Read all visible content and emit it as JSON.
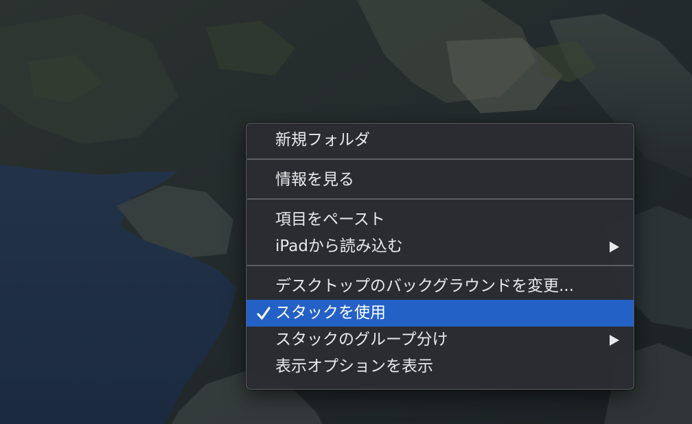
{
  "menu": {
    "items": [
      {
        "label": "新規フォルダ"
      },
      {
        "label": "情報を見る"
      },
      {
        "label": "項目をペースト"
      },
      {
        "label": "iPadから読み込む"
      },
      {
        "label": "デスクトップのバックグラウンドを変更..."
      },
      {
        "label": "スタックを使用",
        "checked": true,
        "highlighted": true
      },
      {
        "label": "スタックのグループ分け"
      },
      {
        "label": "表示オプションを表示"
      }
    ]
  },
  "icons": {
    "check": "checkmark-icon",
    "submenu": "submenu-arrow-icon"
  },
  "colors": {
    "menu_background": "#2c2d32",
    "highlight": "#2361c6",
    "text": "#e9e9ec",
    "separator": "#6e6e76"
  }
}
